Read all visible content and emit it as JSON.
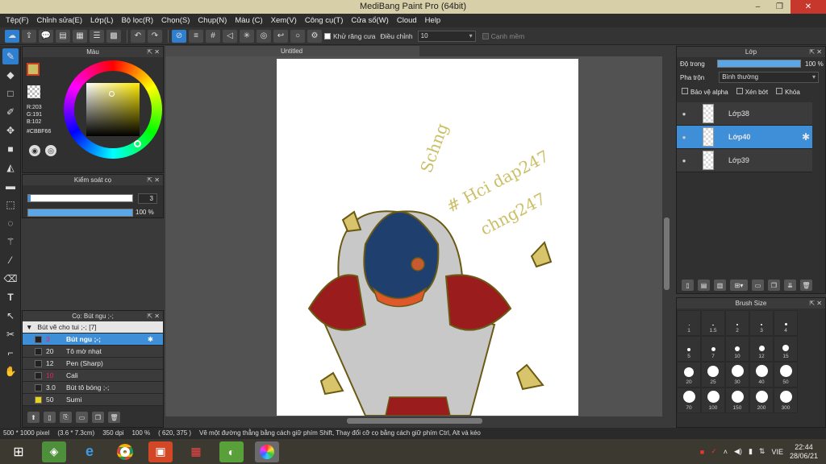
{
  "window": {
    "title": "MediBang Paint Pro (64bit)",
    "minimize": "–",
    "maximize": "❐",
    "close": "✕"
  },
  "menu": [
    "Tệp(F)",
    "Chỉnh sửa(E)",
    "Lớp(L)",
    "Bộ lọc(R)",
    "Chọn(S)",
    "Chụp(N)",
    "Màu (C)",
    "Xem(V)",
    "Công cụ(T)",
    "Cửa sổ(W)",
    "Cloud",
    "Help"
  ],
  "toolbar": {
    "antialias_label": "Khử răng cưa",
    "adjust_label": "Điều chỉnh",
    "adjust_value": "10",
    "edge_label": "Cạnh mềm"
  },
  "color_panel": {
    "title": "Màu",
    "r": "R:203",
    "g": "G:191",
    "b": "B:102",
    "hex": "#CBBF66",
    "primary_color": "#CBBF66"
  },
  "brush_control": {
    "title": "Kiểm soát cọ",
    "size": "3",
    "opacity": "100 %",
    "size_fraction": 0.02,
    "opacity_fraction": 1.0
  },
  "brush_list": {
    "title": "Cọ: Bút ngu ;-;",
    "group": "Bút vẽ cho tui ;-; [7]",
    "items": [
      {
        "size": "3",
        "name": "Bút ngu ;-;",
        "color": "#222222",
        "selected": true
      },
      {
        "size": "20",
        "name": "Tô mờ nhạt",
        "color": "#222222",
        "selected": false
      },
      {
        "size": "12",
        "name": "Pen (Sharp)",
        "color": "#222222",
        "selected": false
      },
      {
        "size": "10",
        "name": "Cali",
        "color": "#222222",
        "selected": false
      },
      {
        "size": "3.0",
        "name": "Bút tô bóng ;-;",
        "color": "#222222",
        "selected": false
      },
      {
        "size": "50",
        "name": "Sumi",
        "color": "#e8d21a",
        "selected": false
      }
    ]
  },
  "document": {
    "tab": "Untitled"
  },
  "layer_panel": {
    "title": "Lớp",
    "opacity_label": "Độ trong",
    "opacity_value": "100 %",
    "blend_label": "Pha trộn",
    "blend_value": "Bình thường",
    "protect_alpha": "Bảo vệ alpha",
    "clip": "Xén bớt",
    "lock": "Khóa",
    "layers": [
      {
        "name": "Lớp38",
        "selected": false
      },
      {
        "name": "Lớp40",
        "selected": true
      },
      {
        "name": "Lớp39",
        "selected": false
      }
    ]
  },
  "brush_size_panel": {
    "title": "Brush Size",
    "sizes": [
      "1",
      "1.5",
      "2",
      "3",
      "4",
      "5",
      "7",
      "10",
      "12",
      "15",
      "20",
      "25",
      "30",
      "40",
      "50",
      "70",
      "100",
      "150",
      "200",
      "300"
    ]
  },
  "status": {
    "dimensions": "500 * 1000 pixel",
    "physical": "(3.6 * 7.3cm)",
    "dpi": "350 dpi",
    "zoom": "100 %",
    "coords": "( 620, 375 )",
    "hint": "Vẽ một đường thẳng bằng cách giữ phím Shift, Thay đổi cỡ cọ bằng cách giữ phím Ctrl, Alt và kéo"
  },
  "taskbar": {
    "lang": "VIE",
    "time": "22:44",
    "date": "28/06/21"
  },
  "canvas_text": {
    "line1": "Schng",
    "line2": "# Hci dap247",
    "line3": "chng247"
  }
}
